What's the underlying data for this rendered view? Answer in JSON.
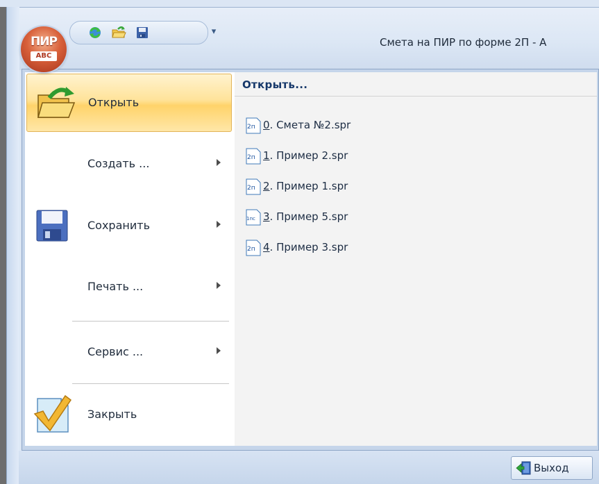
{
  "window": {
    "title": "Смета на ПИР по форме 2П - А"
  },
  "app_button": {
    "logo_top": "ПИР",
    "logo_bottom": "АВС"
  },
  "quick_access": {
    "items": [
      {
        "name": "refresh-icon"
      },
      {
        "name": "open-folder-icon"
      },
      {
        "name": "save-icon"
      }
    ],
    "dropdown_glyph": "▾"
  },
  "menu": {
    "items": [
      {
        "label": "Открыть",
        "icon": "open-folder-icon",
        "has_submenu": false,
        "active": true
      },
      {
        "label": "Создать ...",
        "icon": "",
        "has_submenu": true,
        "active": false
      },
      {
        "label": "Сохранить",
        "icon": "floppy-disk-icon",
        "has_submenu": true,
        "active": false
      },
      {
        "label": "Печать ...",
        "icon": "",
        "has_submenu": true,
        "active": false
      },
      {
        "label": "Сервис ...",
        "icon": "",
        "has_submenu": true,
        "active": false
      },
      {
        "label": "Закрыть",
        "icon": "checkmark-document-icon",
        "has_submenu": false,
        "active": false
      }
    ]
  },
  "recent": {
    "header": "Открыть...",
    "items": [
      {
        "num": "0",
        "text": ". Смета №2.spr",
        "badge": "2п"
      },
      {
        "num": "1",
        "text": ". Пример 2.spr",
        "badge": "2п"
      },
      {
        "num": "2",
        "text": ". Пример 1.spr",
        "badge": "2п"
      },
      {
        "num": "3",
        "text": ". Пример 5.spr",
        "badge": "1пс"
      },
      {
        "num": "4",
        "text": ". Пример 3.spr",
        "badge": "2п"
      }
    ]
  },
  "footer": {
    "exit_label": "Выход"
  },
  "colors": {
    "accent": "#ffd36a",
    "frame": "#c5d5ea",
    "header_text": "#16386a"
  }
}
